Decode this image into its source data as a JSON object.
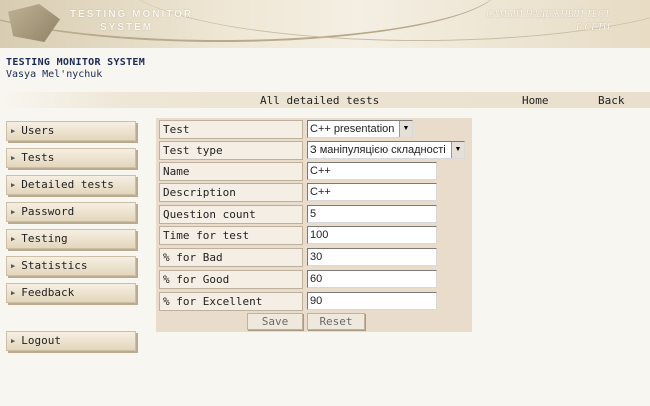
{
  "banner": {
    "brand_line1": "TESTING MONITOR",
    "brand_line2": "SYSTEM",
    "slogan_line1": "САМЫЙ НАДЕЖНЫЙ ТЕСТ",
    "slogan_line2": "В СЕТИ"
  },
  "header": {
    "system_title": "TESTING MONITOR SYSTEM",
    "user_name": "Vasya Mel'nychuk"
  },
  "topnav": {
    "page_title": "All detailed tests",
    "home": "Home",
    "back": "Back"
  },
  "menu": {
    "arrow": "▶",
    "items": [
      {
        "label": "Users"
      },
      {
        "label": "Tests"
      },
      {
        "label": "Detailed tests"
      },
      {
        "label": "Password"
      },
      {
        "label": "Testing"
      },
      {
        "label": "Statistics"
      },
      {
        "label": "Feedback"
      }
    ],
    "logout": "Logout"
  },
  "form": {
    "test": {
      "label": "Test",
      "value": "C++ presentation"
    },
    "test_type": {
      "label": "Test type",
      "value": "З маніпуляцією складності"
    },
    "name": {
      "label": "Name",
      "value": "C++"
    },
    "description": {
      "label": "Description",
      "value": "C++"
    },
    "question_count": {
      "label": "Question count",
      "value": "5"
    },
    "time_for_test": {
      "label": "Time for test",
      "value": "100"
    },
    "pct_bad": {
      "label": "% for Bad",
      "value": "30"
    },
    "pct_good": {
      "label": "% for Good",
      "value": "60"
    },
    "pct_excellent": {
      "label": "% for Excellent",
      "value": "90"
    },
    "save": "Save",
    "reset": "Reset",
    "dropdown_glyph": "▼"
  },
  "colors": {
    "panel": "#e9dccb",
    "title_text": "#1b2a55",
    "menu_button": "#e4d6bd"
  }
}
